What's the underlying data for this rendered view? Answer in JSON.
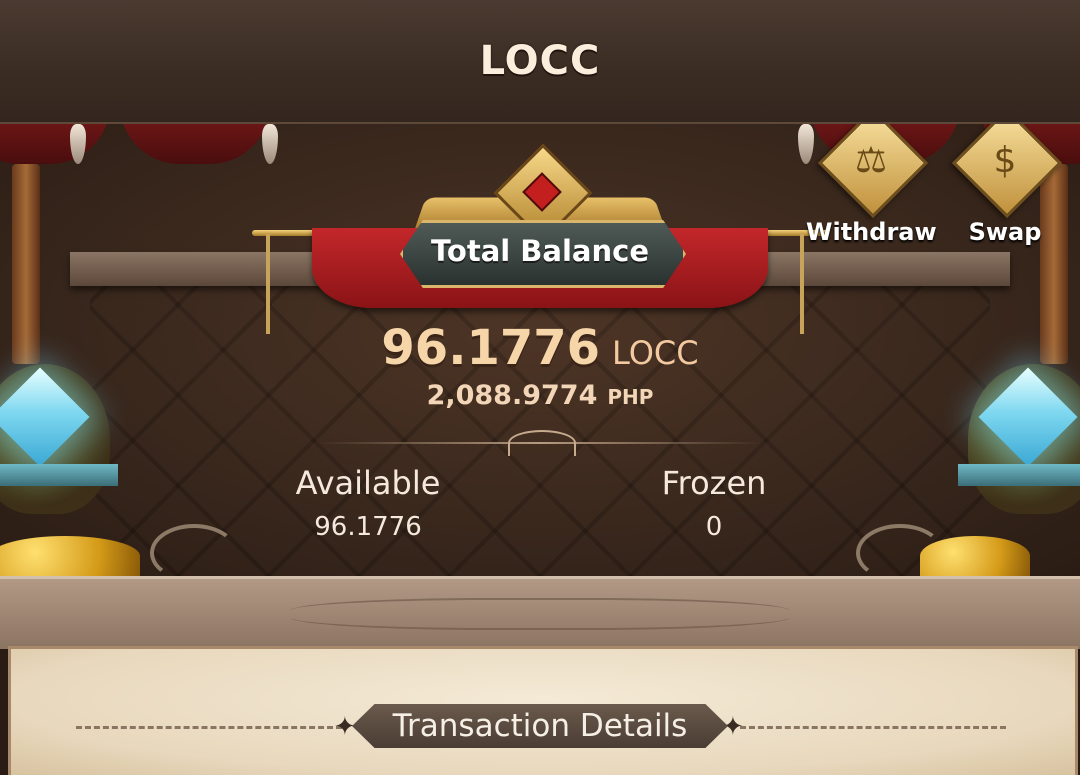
{
  "header": {
    "title": "LOCC"
  },
  "actions": [
    {
      "label": "Withdraw",
      "icon": "scales-icon"
    },
    {
      "label": "Swap",
      "icon": "money-bag-icon"
    }
  ],
  "balance": {
    "title": "Total Balance",
    "amount": "96.1776",
    "currency": "LOCC",
    "fiat_amount": "2,088.9774",
    "fiat_currency": "PHP"
  },
  "stats": {
    "available_label": "Available",
    "available_value": "96.1776",
    "frozen_label": "Frozen",
    "frozen_value": "0"
  },
  "details": {
    "title": "Transaction Details"
  },
  "colors": {
    "accent_gold": "#d9b66b",
    "banner_red": "#c3272a",
    "header_bg": "#3b2c23"
  }
}
